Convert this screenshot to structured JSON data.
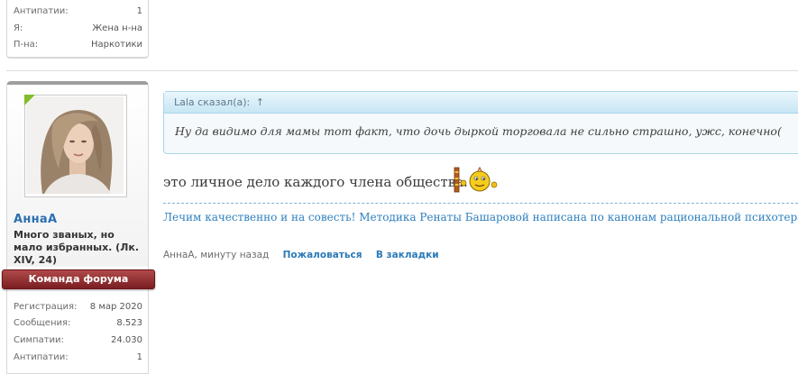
{
  "previous_post_user": {
    "stats": [
      {
        "label": "Антипатии:",
        "value": "1"
      },
      {
        "label": "Я:",
        "value": "Жена н-на"
      },
      {
        "label": "П-на:",
        "value": "Наркотики"
      }
    ]
  },
  "post_user": {
    "username": "АннаА",
    "title": "Много званых, но мало избранных. (Лк. XIV, 24)",
    "banner": "Команда форума",
    "stats": [
      {
        "label": "Регистрация:",
        "value": "8 мар 2020"
      },
      {
        "label": "Сообщения:",
        "value": "8.523"
      },
      {
        "label": "Симпатии:",
        "value": "24.030"
      },
      {
        "label": "Антипатии:",
        "value": "1"
      }
    ]
  },
  "quote": {
    "header": "Lala сказал(а):",
    "arrow": "↑",
    "text": "Ну да видимо для мамы тот факт, что дочь дыркой торговала не сильно страшно, ужс, конечно("
  },
  "message": {
    "text": "это личное дело каждого члена общества.",
    "smiley_icon": "smiley-with-sign-icon"
  },
  "signature": {
    "text": "Лечим качественно и на совесть! Методика Ренаты Башаровой написана по канонам рациональной психотерапии"
  },
  "footer": {
    "author_time": "АннаА, минуту назад",
    "report_label": "Пожаловаться",
    "bookmark_label": "В закладки"
  },
  "colors": {
    "username": "#2b6fb0",
    "banner": "#8a2a2e",
    "quote_border": "#a9d6ea",
    "link": "#2b7ab8"
  }
}
